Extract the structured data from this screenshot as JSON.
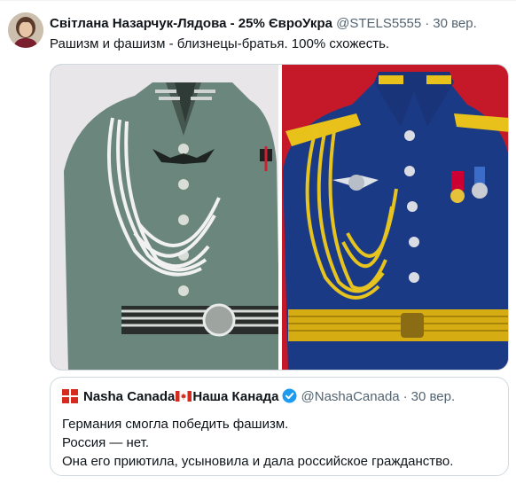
{
  "tweet": {
    "author_name": "Світлана Назарчук-Лядова - 25% ЄвроУкра",
    "handle": "@STELS5555",
    "separator": "·",
    "time": "30 вер.",
    "text": "Рашизм и фашизм - близнецы-братья. 100% схожесть."
  },
  "quoted_tweet": {
    "author_name_part1": "Nasha Canada",
    "author_name_part2": "Наша Канада",
    "handle": "@NashaCanada",
    "separator": "·",
    "time": "30 вер.",
    "lines": [
      "Германия смогла победить фашизм.",
      "Россия — нет.",
      "Она его приютила, усыновила и дала российское гражданство."
    ]
  },
  "colors": {
    "text_primary": "#0f1419",
    "text_secondary": "#536471",
    "border": "#cfd9de",
    "verified": "#1d9bf0",
    "canada_red": "#d52b1e"
  },
  "icons": {
    "verified": "verified-badge-icon",
    "flag": "canada-flag-icon"
  }
}
